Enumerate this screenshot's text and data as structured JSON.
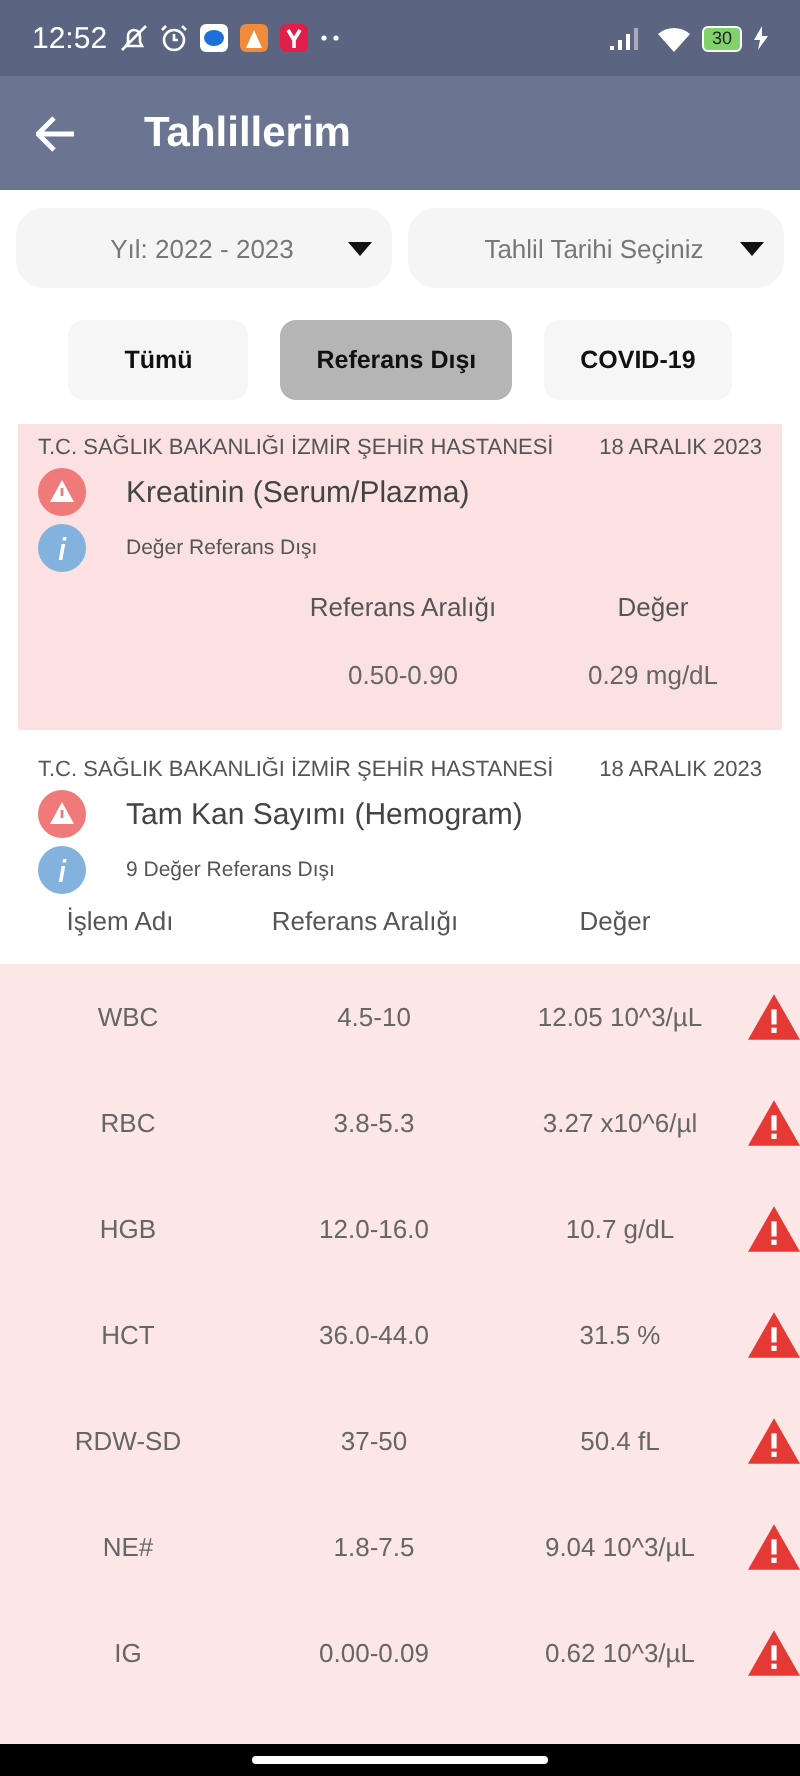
{
  "status_bar": {
    "time": "12:52",
    "battery": "30"
  },
  "app_bar": {
    "title": "Tahlillerim"
  },
  "dropdowns": [
    {
      "value": "Yıl: 2022 - 2023"
    },
    {
      "value": "Tahlil Tarihi Seçiniz"
    }
  ],
  "filters": [
    {
      "label": "Tümü",
      "selected": false
    },
    {
      "label": "Referans Dışı",
      "selected": true
    },
    {
      "label": "COVID-19",
      "selected": false
    }
  ],
  "results": [
    {
      "hospital": "T.C. SAĞLIK BAKANLIĞI İZMİR ŞEHİR HASTANESİ",
      "date": "18 ARALIK 2023",
      "test": "Kreatinin (Serum/Plazma)",
      "note": "Değer Referans Dışı",
      "highlighted": true,
      "columns": [
        "Referans Aralığı",
        "Değer"
      ],
      "rows": [
        {
          "cells": [
            "0.50-0.90",
            "0.29 mg/dL"
          ]
        }
      ]
    },
    {
      "hospital": "T.C. SAĞLIK BAKANLIĞI İZMİR ŞEHİR HASTANESİ",
      "date": "18 ARALIK 2023",
      "test": "Tam Kan Sayımı (Hemogram)",
      "note": "9 Değer Referans Dışı",
      "highlighted": false,
      "columns": [
        "İşlem Adı",
        "Referans Aralığı",
        "Değer"
      ],
      "rows": [
        {
          "cells": [
            "WBC",
            "4.5-10",
            "12.05 10^3/µL"
          ],
          "warning": true
        },
        {
          "cells": [
            "RBC",
            "3.8-5.3",
            "3.27 x10^6/µl"
          ],
          "warning": true
        },
        {
          "cells": [
            "HGB",
            "12.0-16.0",
            "10.7 g/dL"
          ],
          "warning": true
        },
        {
          "cells": [
            "HCT",
            "36.0-44.0",
            "31.5 %"
          ],
          "warning": true
        },
        {
          "cells": [
            "RDW-SD",
            "37-50",
            "50.4 fL"
          ],
          "warning": true
        },
        {
          "cells": [
            "NE#",
            "1.8-7.5",
            "9.04 10^3/µL"
          ],
          "warning": true
        },
        {
          "cells": [
            "IG",
            "0.00-0.09",
            "0.62 10^3/µL"
          ],
          "warning": true
        }
      ]
    }
  ]
}
